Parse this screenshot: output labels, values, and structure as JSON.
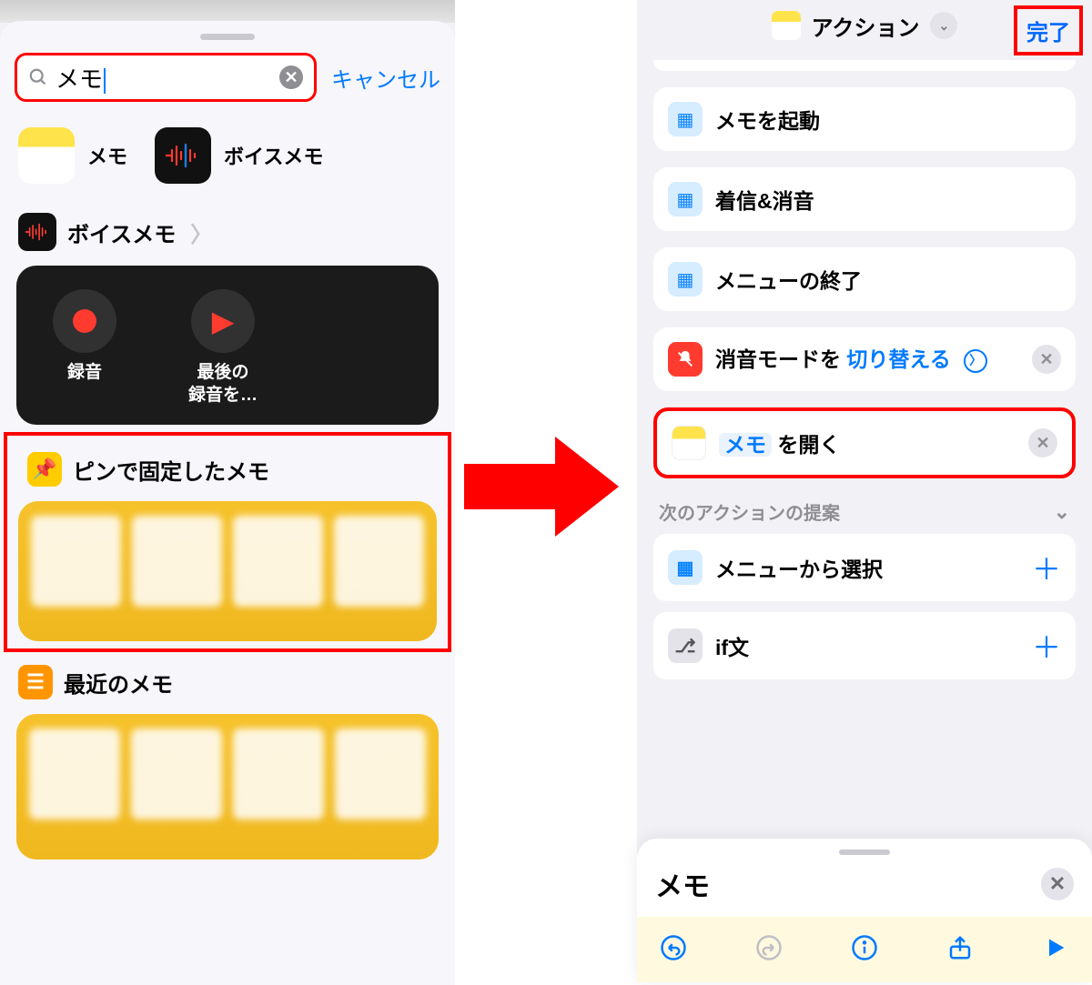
{
  "left": {
    "search": {
      "value": "メモ",
      "cancel": "キャンセル"
    },
    "apps": {
      "notes": "メモ",
      "voice": "ボイスメモ"
    },
    "voice_section": {
      "title": "ボイスメモ",
      "record": "録音",
      "last": "最後の\n録音を…"
    },
    "pinned": {
      "title": "ピンで固定したメモ"
    },
    "recent": {
      "title": "最近のメモ"
    }
  },
  "right": {
    "header": {
      "title": "アクション",
      "done": "完了"
    },
    "cards": {
      "launch": "メモを起動",
      "ring": "着信&消音",
      "endmenu": "メニューの終了",
      "silent_prefix": "消音モードを ",
      "silent_param": "切り替える",
      "open_prefix": "",
      "open_param": "メモ",
      "open_suffix": " を開く"
    },
    "suggestions": {
      "title": "次のアクションの提案",
      "menu_select": "メニューから選択",
      "if_stmt": "if文"
    },
    "bottom": {
      "title": "メモ"
    }
  }
}
